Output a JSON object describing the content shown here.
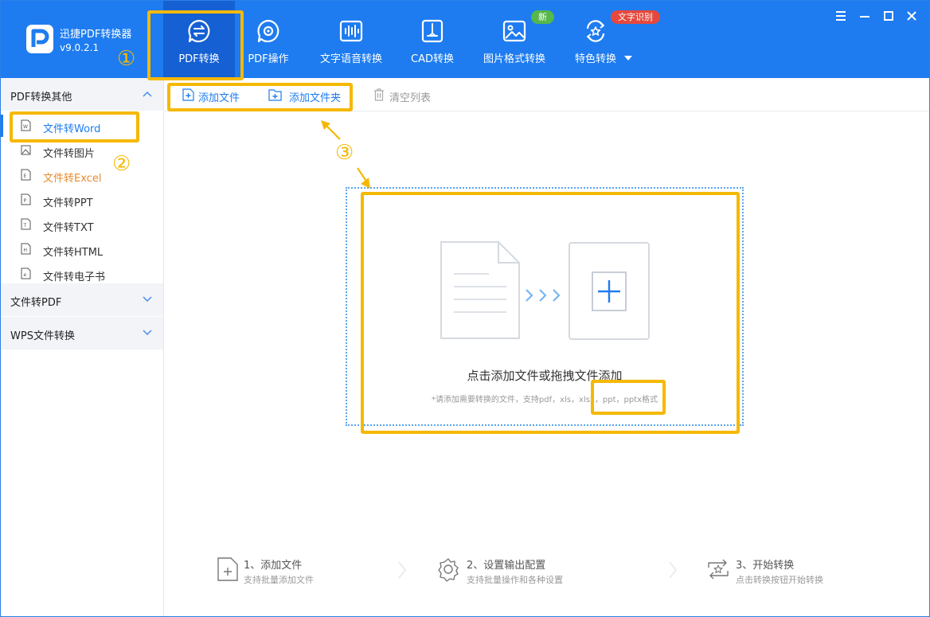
{
  "app": {
    "name": "迅捷PDF转换器",
    "version": "v9.0.2.1"
  },
  "tabs": [
    {
      "label": "PDF转换",
      "icon": "pdf-convert-icon",
      "active": true
    },
    {
      "label": "PDF操作",
      "icon": "pdf-operate-icon"
    },
    {
      "label": "文字语音转换",
      "icon": "audio-wave-icon"
    },
    {
      "label": "CAD转换",
      "icon": "cad-icon"
    },
    {
      "label": "图片格式转换",
      "icon": "image-icon"
    },
    {
      "label": "特色转换",
      "icon": "star-convert-icon"
    }
  ],
  "badges": {
    "new": "新",
    "ocr": "文字识别"
  },
  "sidebar": {
    "group1": "PDF转换其他",
    "items": [
      {
        "label": "文件转Word",
        "icon": "word-file-icon"
      },
      {
        "label": "文件转图片",
        "icon": "image-file-icon"
      },
      {
        "label": "文件转Excel",
        "icon": "excel-file-icon"
      },
      {
        "label": "文件转PPT",
        "icon": "ppt-file-icon"
      },
      {
        "label": "文件转TXT",
        "icon": "txt-file-icon"
      },
      {
        "label": "文件转HTML",
        "icon": "html-file-icon"
      },
      {
        "label": "文件转电子书",
        "icon": "ebook-file-icon"
      }
    ],
    "group2": "文件转PDF",
    "group3": "WPS文件转换"
  },
  "toolbar": {
    "add_file": "添加文件",
    "add_folder": "添加文件夹",
    "clear_list": "清空列表"
  },
  "dropzone": {
    "title": "点击添加文件或拖拽文件添加",
    "hint": "*请添加需要转换的文件，支持pdf，xls，xlsx，ppt，pptx格式"
  },
  "annotations": {
    "one": "①",
    "two": "②",
    "three": "③"
  },
  "steps": [
    {
      "title": "1、添加文件",
      "sub": "支持批量添加文件"
    },
    {
      "title": "2、设置输出配置",
      "sub": "支持批量操作和各种设置"
    },
    {
      "title": "3、开始转换",
      "sub": "点击转换按钮开始转换"
    }
  ],
  "colors": {
    "brand": "#1e7cf0",
    "highlight": "#f5b800",
    "badge_new": "#55b74c",
    "badge_ocr": "#e5483c"
  }
}
